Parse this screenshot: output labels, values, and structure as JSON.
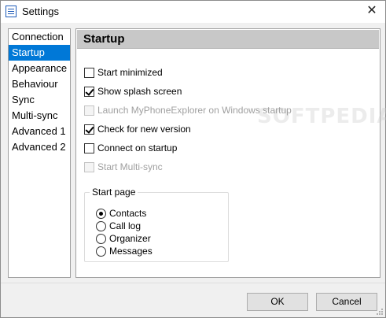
{
  "window": {
    "title": "Settings",
    "close_glyph": "✕",
    "icon": "settings-window-icon"
  },
  "sidebar": {
    "items": [
      {
        "label": "Connection"
      },
      {
        "label": "Startup",
        "selected": true
      },
      {
        "label": "Appearance"
      },
      {
        "label": "Behaviour"
      },
      {
        "label": "Sync"
      },
      {
        "label": "Multi-sync"
      },
      {
        "label": "Advanced 1"
      },
      {
        "label": "Advanced 2"
      }
    ]
  },
  "panel": {
    "title": "Startup",
    "options": [
      {
        "label": "Start minimized",
        "checked": false,
        "enabled": true
      },
      {
        "label": "Show splash screen",
        "checked": true,
        "enabled": true
      },
      {
        "label": "Launch MyPhoneExplorer on Windows startup",
        "checked": false,
        "enabled": false
      },
      {
        "label": "Check for new version",
        "checked": true,
        "enabled": true
      },
      {
        "label": "Connect on startup",
        "checked": false,
        "enabled": true
      },
      {
        "label": "Start Multi-sync",
        "checked": false,
        "enabled": false
      }
    ],
    "start_page": {
      "label": "Start page",
      "options": [
        {
          "label": "Contacts",
          "selected": true
        },
        {
          "label": "Call log",
          "selected": false
        },
        {
          "label": "Organizer",
          "selected": false
        },
        {
          "label": "Messages",
          "selected": false
        }
      ]
    },
    "watermark": "SOFTPEDIA"
  },
  "footer": {
    "ok_label": "OK",
    "cancel_label": "Cancel"
  },
  "colors": {
    "selection": "#0078d7",
    "header_bg": "#c8c8c8",
    "dialog_bg": "#f0f0f0"
  }
}
